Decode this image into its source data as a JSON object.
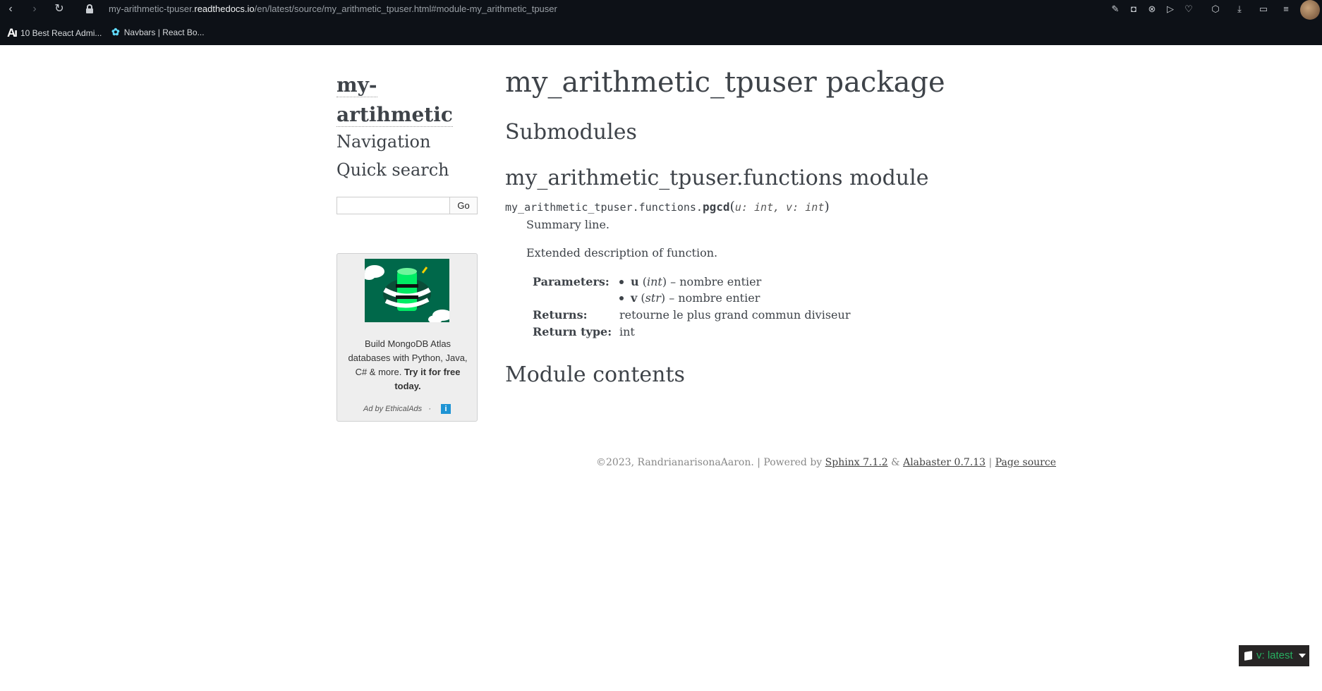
{
  "browser": {
    "url_prefix": "my-arithmetic-tpuser.",
    "url_host": "readthedocs.io",
    "url_path": "/en/latest/source/my_arithmetic_tpuser.html#module-my_arithmetic_tpuser",
    "bookmarks": [
      {
        "label": "10 Best React Admi...",
        "icon": "Aı"
      },
      {
        "label": "Navbars | React Bo...",
        "icon": "✿"
      }
    ]
  },
  "sidebar": {
    "logo_line1": "my-",
    "logo_line2": "artihmetic",
    "navigation": "Navigation",
    "quick_search": "Quick search",
    "search_value": "",
    "go_label": "Go"
  },
  "ad": {
    "text_plain": "Build MongoDB Atlas databases with Python, Java, C# & more.",
    "text_bold": "Try it for free today.",
    "by": "Ad by EthicalAds",
    "sep": "·",
    "info": "i"
  },
  "main": {
    "title": "my_arithmetic_tpuser package",
    "submodules": "Submodules",
    "module_heading": "my_arithmetic_tpuser.functions module",
    "sig_prefix": "my_arithmetic_tpuser.functions.",
    "sig_name": "pgcd",
    "sig_params": "u: int, v: int",
    "summary": "Summary line.",
    "extended": "Extended description of function.",
    "params_label": "Parameters:",
    "params": [
      {
        "name": "u",
        "type": "int",
        "desc": " – nombre entier"
      },
      {
        "name": "v",
        "type": "str",
        "desc": " – nombre entier"
      }
    ],
    "returns_label": "Returns:",
    "returns": "retourne le plus grand commun diviseur",
    "return_type_label": "Return type:",
    "return_type": "int",
    "module_contents": "Module contents"
  },
  "footer": {
    "copyright": "©2023, RandrianarisonaAaron. | Powered by ",
    "sphinx": "Sphinx 7.1.2",
    "amp": " & ",
    "alabaster": "Alabaster 0.7.13",
    "sep": " | ",
    "page_source": "Page source"
  },
  "rtd": {
    "version": "v: latest"
  }
}
